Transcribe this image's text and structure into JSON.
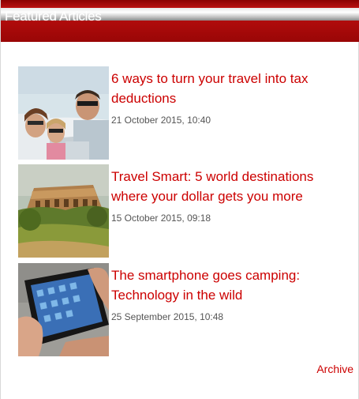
{
  "header": {
    "title": "Featured Articles"
  },
  "articles": [
    {
      "headline": "6 ways to turn your travel into tax deductions",
      "date": "21 October 2015, 10:40",
      "image": "family-in-car-photo"
    },
    {
      "headline": "Travel Smart: 5 world destinations where your dollar gets you more",
      "date": "15 October 2015, 09:18",
      "image": "colosseum-photo"
    },
    {
      "headline": "The smartphone goes camping: Technology in the wild",
      "date": "25 September 2015, 10:48",
      "image": "smartphone-photo"
    }
  ],
  "archive_label": "Archive",
  "colors": {
    "accent": "#cc0000",
    "header": "#b00c0c",
    "date_text": "#555555"
  }
}
